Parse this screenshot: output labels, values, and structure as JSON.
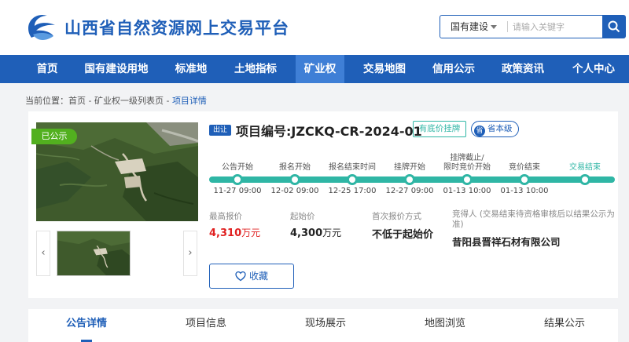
{
  "header": {
    "site_title": "山西省自然资源网上交易平台",
    "search_category": "国有建设",
    "search_placeholder": "请输入关键字"
  },
  "nav": {
    "items": [
      "首页",
      "国有建设用地",
      "标准地",
      "土地指标",
      "矿业权",
      "交易地图",
      "信用公示",
      "政策资讯",
      "个人中心"
    ],
    "active": "矿业权"
  },
  "breadcrumb": {
    "prefix": "当前位置：",
    "path": "首页 - 矿业权一级列表页 - ",
    "current": "项目详情"
  },
  "project": {
    "status_tag": "已公示",
    "listing_badge": "出让",
    "project_no": "项目编号:JZCKQ-CR-2024-01",
    "reserve_tag": "有底价挂牌",
    "level_icon_text": "省",
    "level_tag": "省本级"
  },
  "timeline": [
    {
      "label": "公告开始",
      "date": "11-27 09:00"
    },
    {
      "label": "报名开始",
      "date": "12-02 09:00"
    },
    {
      "label": "报名结束时间",
      "date": "12-25 17:00"
    },
    {
      "label": "挂牌开始",
      "date": "12-27 09:00"
    },
    {
      "label": "挂牌截止/\n限时竞价开始",
      "date": "01-13 10:00"
    },
    {
      "label": "竞价结束",
      "date": "01-13 10:00"
    },
    {
      "label": "交易结束",
      "date": ""
    }
  ],
  "info": {
    "highest_bid_label": "最高报价",
    "highest_bid_value": "4,310",
    "highest_bid_unit": "万元",
    "start_price_label": "起始价",
    "start_price_value": "4,300",
    "start_price_unit": "万元",
    "first_bid_label": "首次报价方式",
    "first_bid_value": "不低于起始价",
    "winner_label": "竞得人 (交易结束待资格审核后以结果公示为准)",
    "winner_value": "昔阳县晋祥石材有限公司"
  },
  "favorite_label": "收藏",
  "tabs": [
    "公告详情",
    "项目信息",
    "现场展示",
    "地图浏览",
    "结果公示"
  ],
  "active_tab": "公告详情",
  "colors": {
    "brand_blue": "#1f5fb8",
    "teal": "#2fb6a5",
    "price_red": "#e02020",
    "status_green": "#52b01f"
  }
}
